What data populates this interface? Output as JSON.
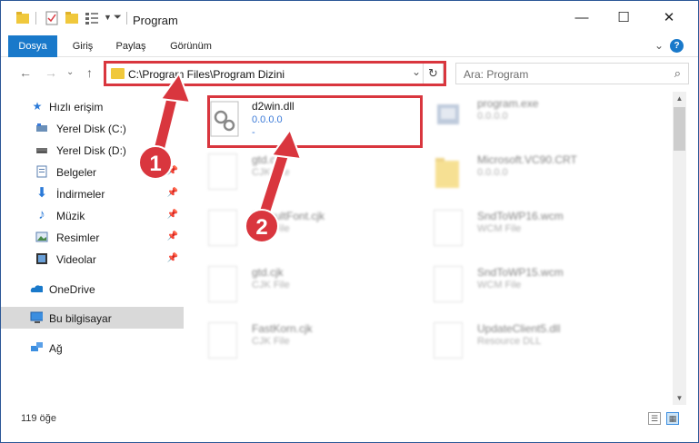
{
  "window": {
    "title": "Program",
    "minimize": "—",
    "maximize": "☐",
    "close": "✕"
  },
  "ribbon": {
    "tabs": [
      "Dosya",
      "Giriş",
      "Paylaş",
      "Görünüm"
    ],
    "expand": "⌄",
    "help": "?"
  },
  "nav": {
    "back": "←",
    "forward": "→",
    "recent": "⌄",
    "up": "↑",
    "address": "C:\\Program Files\\Program Dizini",
    "search_placeholder": "Ara: Program"
  },
  "sidebar": {
    "items": [
      {
        "label": "Hızlı erişim",
        "icon": "star-icon"
      },
      {
        "label": "Yerel Disk (C:)",
        "icon": "drive-c-icon"
      },
      {
        "label": "Yerel Disk (D:)",
        "icon": "drive-d-icon"
      },
      {
        "label": "Belgeler",
        "icon": "documents-icon"
      },
      {
        "label": "İndirmeler",
        "icon": "downloads-icon"
      },
      {
        "label": "Müzik",
        "icon": "music-icon"
      },
      {
        "label": "Resimler",
        "icon": "pictures-icon"
      },
      {
        "label": "Videolar",
        "icon": "videos-icon"
      },
      {
        "label": "OneDrive",
        "icon": "onedrive-icon"
      },
      {
        "label": "Bu bilgisayar",
        "icon": "this-pc-icon"
      },
      {
        "label": "Ağ",
        "icon": "network-icon"
      }
    ]
  },
  "files": [
    {
      "name": "d2win.dll",
      "line1": "0.0.0.0",
      "line2": "-"
    },
    {
      "name": "program.exe",
      "line1": "0.0.0.0",
      "line2": ""
    },
    {
      "name": "gtd.cjk",
      "line1": "CJK File",
      "line2": ""
    },
    {
      "name": "Microsoft.VC90.CRT",
      "line1": "0.0.0.0",
      "line2": ""
    },
    {
      "name": "DefaultFont.cjk",
      "line1": "CJK File",
      "line2": ""
    },
    {
      "name": "SndToWP16.wcm",
      "line1": "WCM File",
      "line2": ""
    },
    {
      "name": "gtd.cjk",
      "line1": "CJK File",
      "line2": ""
    },
    {
      "name": "SndToWP15.wcm",
      "line1": "WCM File",
      "line2": ""
    },
    {
      "name": "FastKorn.cjk",
      "line1": "CJK File",
      "line2": ""
    },
    {
      "name": "UpdateClient5.dll",
      "line1": "Resource DLL",
      "line2": ""
    }
  ],
  "status": {
    "count": "119 öğe"
  },
  "annotations": {
    "step1": "1",
    "step2": "2"
  },
  "colors": {
    "accent": "#1979ca",
    "highlight": "#d9363e"
  }
}
